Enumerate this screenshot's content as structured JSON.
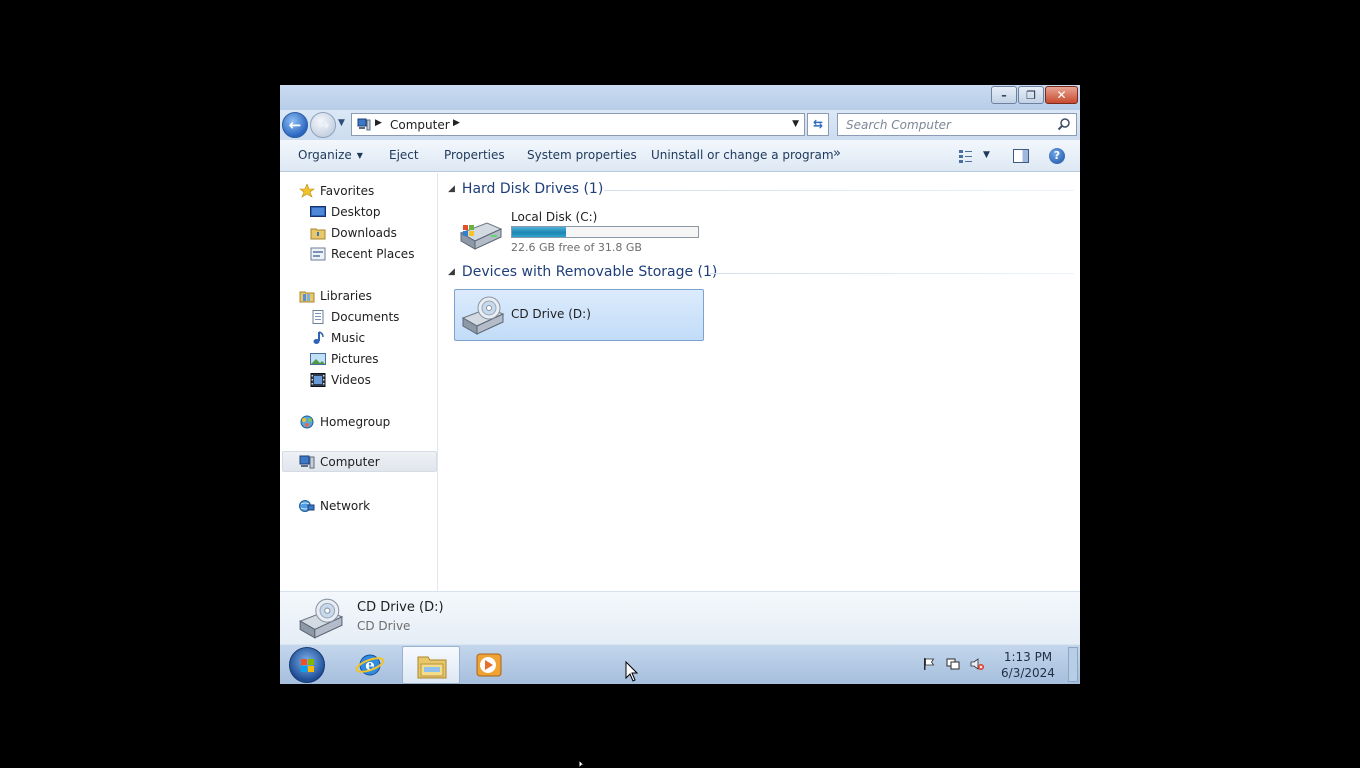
{
  "window": {
    "caption_buttons": {
      "minimize": "–",
      "restore": "❐",
      "close": "✕"
    },
    "navigation": {
      "back": "←",
      "forward": "→"
    },
    "address": {
      "breadcrumb": "Computer"
    },
    "search": {
      "placeholder": "Search Computer"
    }
  },
  "commands": {
    "organize": "Organize",
    "eject": "Eject",
    "properties": "Properties",
    "system_properties": "System properties",
    "uninstall": "Uninstall or change a program",
    "more": "»",
    "help": "?"
  },
  "sidebar": {
    "favorites": {
      "label": "Favorites",
      "items": [
        "Desktop",
        "Downloads",
        "Recent Places"
      ]
    },
    "libraries": {
      "label": "Libraries",
      "items": [
        "Documents",
        "Music",
        "Pictures",
        "Videos"
      ]
    },
    "homegroup": "Homegroup",
    "computer": "Computer",
    "network": "Network"
  },
  "content": {
    "hard_disk_group": "Hard Disk Drives (1)",
    "removable_group": "Devices with Removable Storage (1)",
    "drive_c": {
      "name": "Local Disk (C:)",
      "free_text": "22.6 GB free of 31.8 GB",
      "used_fraction": 0.29
    },
    "drive_d": {
      "name": "CD Drive (D:)"
    }
  },
  "details": {
    "name": "CD Drive (D:)",
    "type": "CD Drive"
  },
  "taskbar": {
    "time": "1:13 PM",
    "date": "6/3/2024"
  },
  "colors": {
    "accent": "#1e3f7a",
    "selection": "#c2dcf8",
    "taskbar": "#a6bfdd"
  }
}
